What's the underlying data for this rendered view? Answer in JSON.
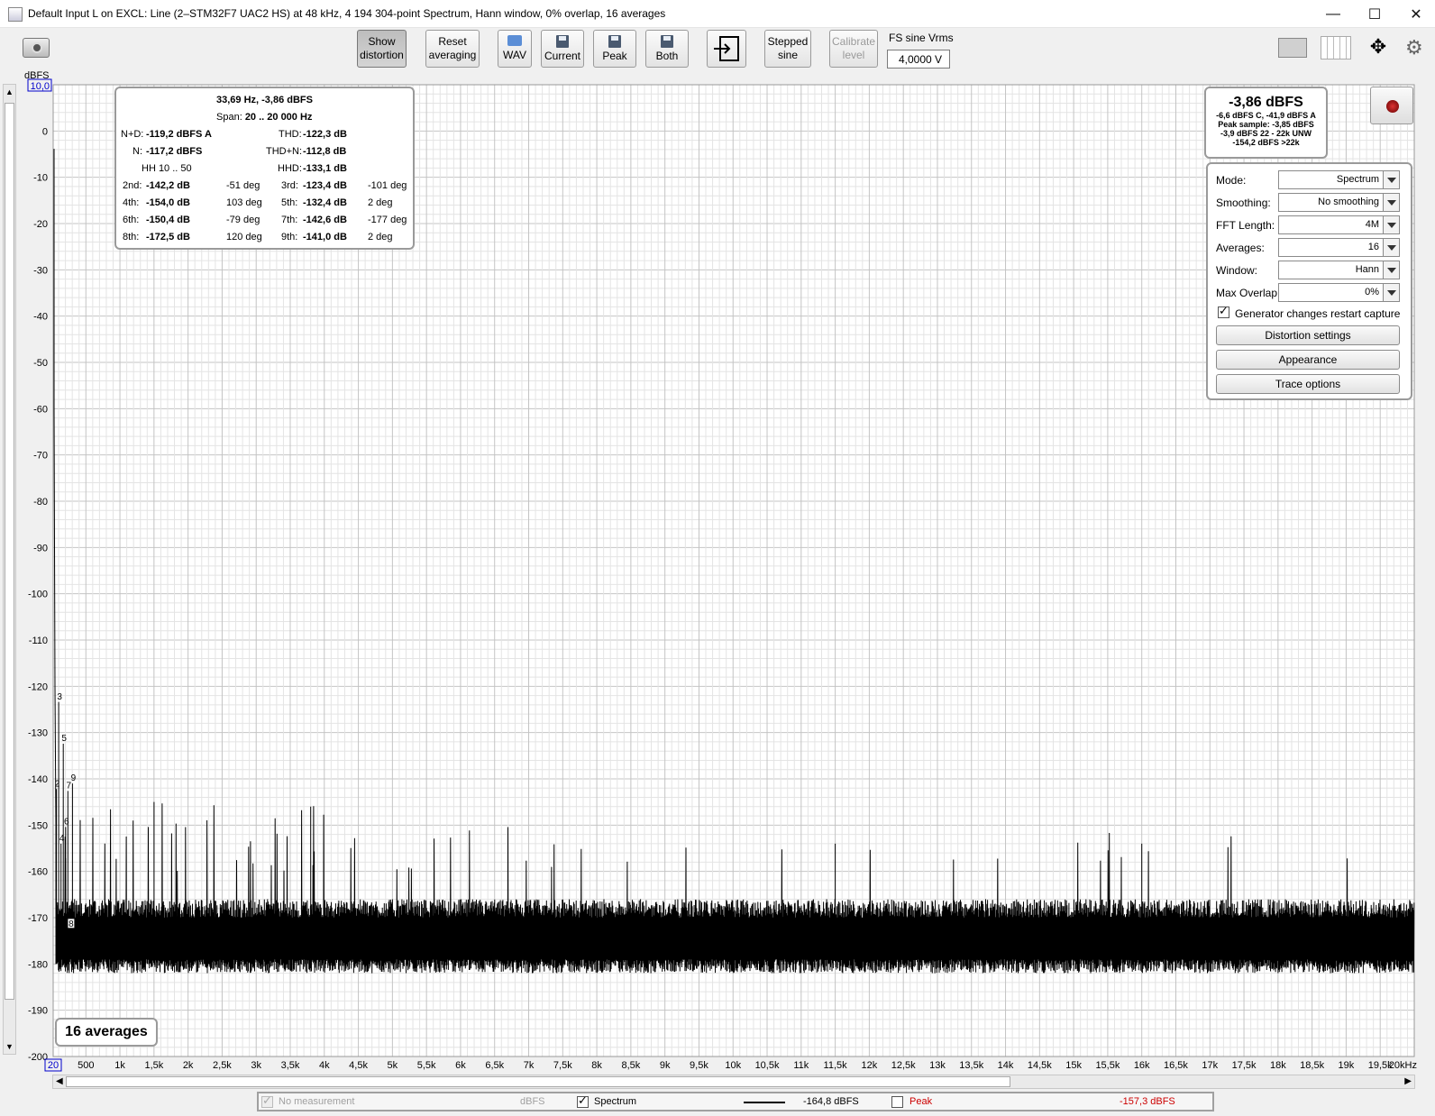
{
  "window": {
    "title": "Default Input L on EXCL: Line (2–STM32F7 UAC2 HS) at 48 kHz, 4 194 304-point Spectrum, Hann window, 0% overlap, 16 averages",
    "minimize": "—",
    "maximize": "☐",
    "close": "✕"
  },
  "toolbar": {
    "show_distortion": [
      "Show",
      "distortion"
    ],
    "reset_averaging": [
      "Reset",
      "averaging"
    ],
    "wav": "WAV",
    "current": "Current",
    "peak": "Peak",
    "both": "Both",
    "stepped_sine": [
      "Stepped",
      "sine"
    ],
    "calibrate_level": [
      "Calibrate",
      "level"
    ],
    "fs_sine_label": "FS sine Vrms",
    "fs_sine_value": "4,0000 V"
  },
  "distortion": {
    "header": "33,69 Hz, -3,86 dBFS",
    "span_label": "Span:",
    "span_value": "20 .. 20 000 Hz",
    "nd_label": "N+D:",
    "nd_value": "-119,2 dBFS A",
    "thd_label": "THD:",
    "thd_value": "-122,3 dB",
    "n_label": "N:",
    "n_value": "-117,2 dBFS",
    "thdn_label": "THD+N:",
    "thdn_value": "-112,8 dB",
    "hh": "HH 10 .. 50",
    "hhd_label": "HHD:",
    "hhd_value": "-133,1 dB",
    "rows": [
      {
        "l1": "2nd:",
        "v1": "-142,2 dB",
        "p1": "-51 deg",
        "l2": "3rd:",
        "v2": "-123,4 dB",
        "p2": "-101 deg"
      },
      {
        "l1": "4th:",
        "v1": "-154,0 dB",
        "p1": "103 deg",
        "l2": "5th:",
        "v2": "-132,4 dB",
        "p2": "2 deg"
      },
      {
        "l1": "6th:",
        "v1": "-150,4 dB",
        "p1": "-79 deg",
        "l2": "7th:",
        "v2": "-142,6 dB",
        "p2": "-177 deg"
      },
      {
        "l1": "8th:",
        "v1": "-172,5 dB",
        "p1": "120 deg",
        "l2": "9th:",
        "v2": "-141,0 dB",
        "p2": "2 deg"
      }
    ]
  },
  "level_box": {
    "main": "-3,86 dBFS",
    "line1": "-6,6 dBFS C, -41,9 dBFS A",
    "line2": "Peak sample: -3,85 dBFS",
    "line3": "-3,9 dBFS 22 - 22k UNW",
    "line4": "-154,2 dBFS >22k"
  },
  "controls": {
    "mode_label": "Mode:",
    "mode_value": "Spectrum",
    "smoothing_label": "Smoothing:",
    "smoothing_value": "No  smoothing",
    "fft_label": "FFT Length:",
    "fft_value": "4M",
    "averages_label": "Averages:",
    "averages_value": "16",
    "window_label": "Window:",
    "window_value": "Hann",
    "overlap_label": "Max Overlap:",
    "overlap_value": "0%",
    "restart_label": "Generator changes restart capture",
    "restart_checked": true,
    "distortion_settings": "Distortion settings",
    "appearance": "Appearance",
    "trace_options": "Trace options"
  },
  "averages_badge": "16 averages",
  "legend": {
    "no_measurement": "No measurement",
    "unit": "dBFS",
    "spectrum": "Spectrum",
    "spectrum_checked": true,
    "spectrum_value": "-164,8 dBFS",
    "peak": "Peak",
    "peak_checked": false,
    "peak_value": "-157,3 dBFS",
    "peak_color": "#cc0000"
  },
  "chart_data": {
    "type": "line",
    "ylabel": "dBFS",
    "ylim": [
      -200,
      10
    ],
    "xlim": [
      20,
      20000
    ],
    "xunit": "kHz",
    "y_ticks": [
      "10,0",
      "0",
      "-10",
      "-20",
      "-30",
      "-40",
      "-50",
      "-60",
      "-70",
      "-80",
      "-90",
      "-100",
      "-110",
      "-120",
      "-130",
      "-140",
      "-150",
      "-160",
      "-170",
      "-180",
      "-190",
      "-200"
    ],
    "x_ticks": [
      "20",
      "500",
      "1k",
      "1,5k",
      "2k",
      "2,5k",
      "3k",
      "3,5k",
      "4k",
      "4,5k",
      "5k",
      "5,5k",
      "6k",
      "6,5k",
      "7k",
      "7,5k",
      "8k",
      "8,5k",
      "9k",
      "9,5k",
      "10k",
      "10,5k",
      "11k",
      "11,5k",
      "12k",
      "12,5k",
      "13k",
      "13,5k",
      "14k",
      "14,5k",
      "15k",
      "15,5k",
      "16k",
      "16,5k",
      "17k",
      "17,5k",
      "18k",
      "18,5k",
      "19k",
      "19,5k",
      "20kHz"
    ],
    "series": [
      {
        "name": "Spectrum",
        "noise_floor": [
          -182,
          -170
        ]
      }
    ],
    "harmonic_markers": [
      {
        "label": "3",
        "x": 101,
        "y": -123.4
      },
      {
        "label": "5",
        "x": 168,
        "y": -132.4
      },
      {
        "label": "2",
        "x": 67,
        "y": -142.2
      },
      {
        "label": "7",
        "x": 236,
        "y": -142.6
      },
      {
        "label": "9",
        "x": 303,
        "y": -141.0
      },
      {
        "label": "6",
        "x": 202,
        "y": -150.4
      },
      {
        "label": "4",
        "x": 135,
        "y": -154.0
      },
      {
        "label": "8",
        "x": 270,
        "y": -172.5
      }
    ],
    "spurs": [
      {
        "x": 16000,
        "y": -154
      },
      {
        "x": 11500,
        "y": -154
      },
      {
        "x": 3800,
        "y": -146
      },
      {
        "x": 1500,
        "y": -145
      }
    ]
  }
}
